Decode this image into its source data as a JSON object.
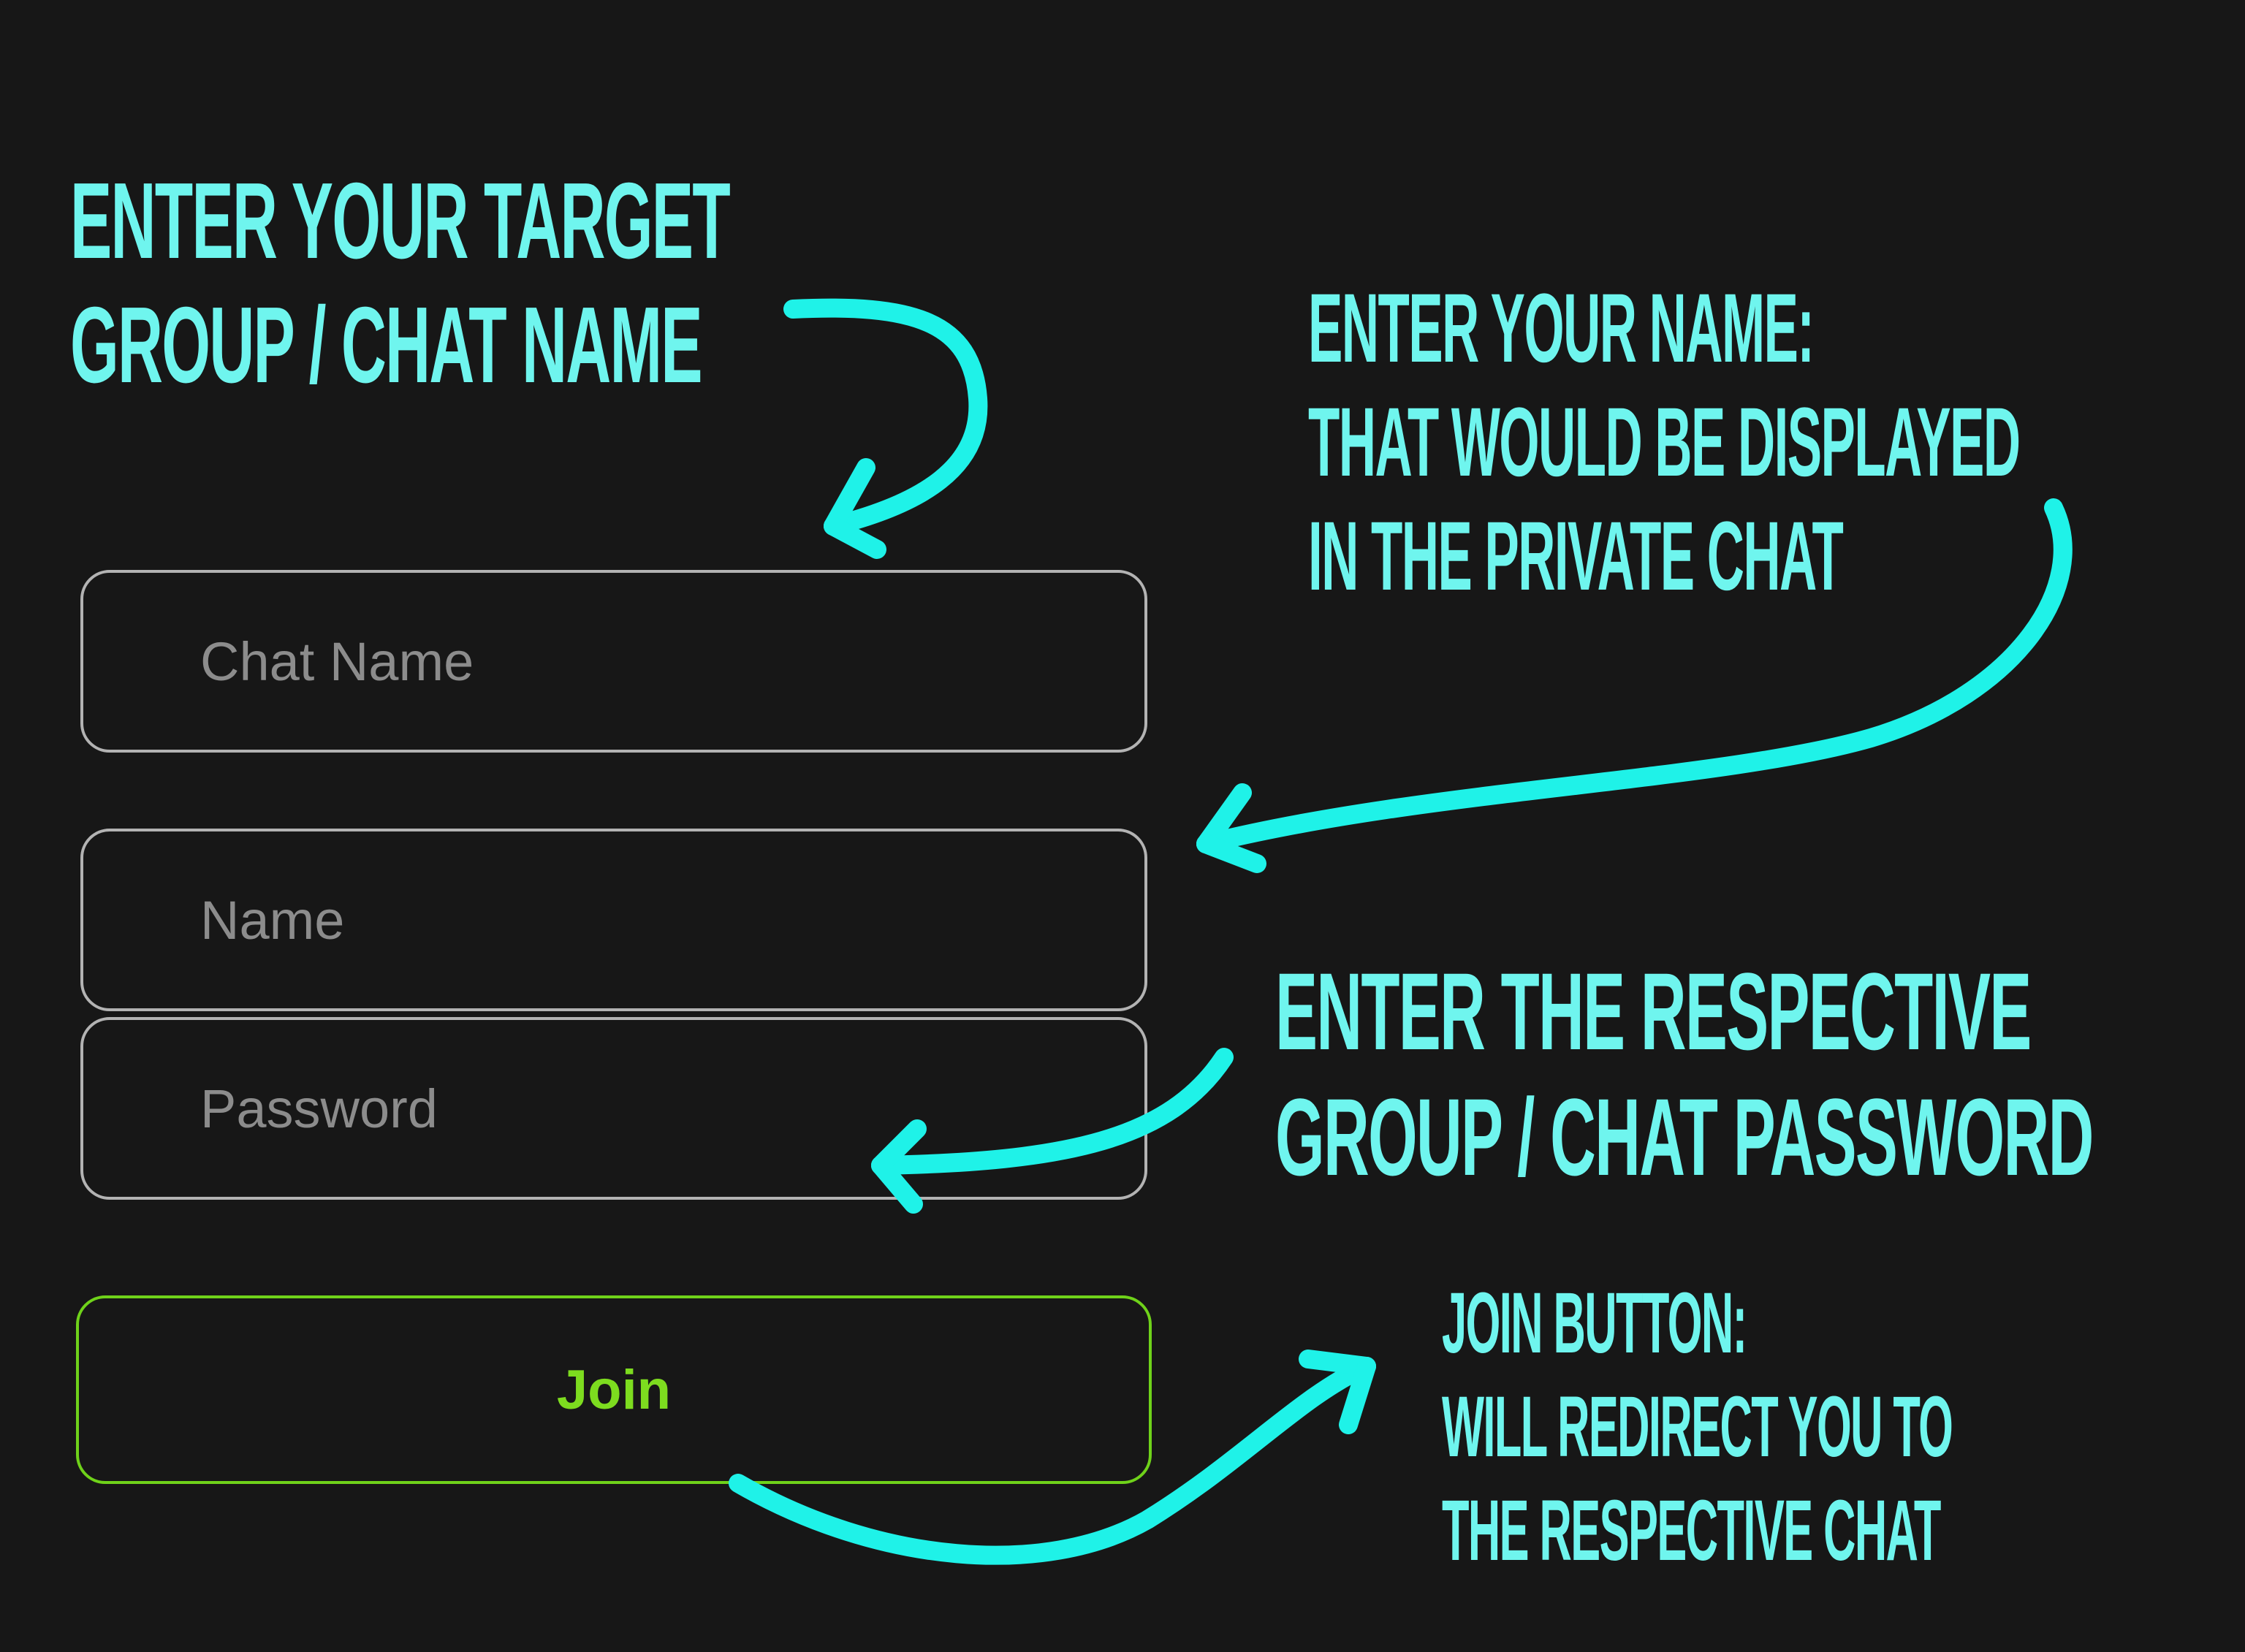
{
  "form": {
    "chat_name_placeholder": "Chat Name",
    "name_placeholder": "Name",
    "password_placeholder": "Password",
    "join_label": "Join"
  },
  "annotations": {
    "chat_name": "ENTER YOUR TARGET\nGROUP / CHAT NAME",
    "name": "ENTER YOUR NAME:\nTHAT WOULD BE DISPLAYED\nIN THE PRIVATE CHAT",
    "password": "ENTER THE RESPECTIVE\nGROUP / CHAT PASSWORD",
    "join": "JOIN BUTTON:\nWILL REDIRECT YOU TO\nTHE RESPECTIVE CHAT"
  },
  "colors": {
    "background": "#171717",
    "field_border": "#b3b3b3",
    "placeholder": "#8c8c8c",
    "join_accent": "#7ddc1f",
    "annotation_text": "#6ff5ee",
    "annotation_arrow": "#1ff2e8"
  }
}
